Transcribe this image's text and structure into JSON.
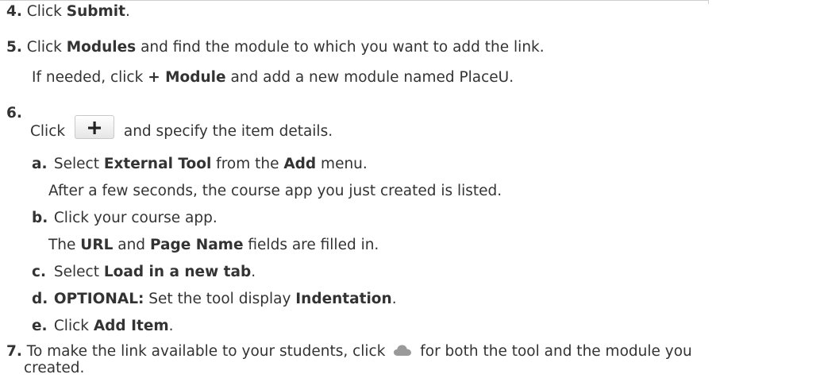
{
  "steps": {
    "s4": {
      "num": "4.",
      "pre": "Click ",
      "b1": "Submit",
      "post": "."
    },
    "s5": {
      "num": "5.",
      "pre": "Click ",
      "b1": "Modules",
      "post": " and find the module to which you want to add the link.",
      "note_pre": "If needed, click ",
      "note_b": "+ Module",
      "note_post": " and add a new module named PlaceU."
    },
    "s6": {
      "num": "6.",
      "pre": "Click",
      "post": "and specify the item details.",
      "a": {
        "letter": "a.",
        "pre": "Select ",
        "b1": "External Tool",
        "mid": " from the ",
        "b2": "Add",
        "post": " menu.",
        "note": "After a few seconds, the course app you just created is listed."
      },
      "b": {
        "letter": "b.",
        "text": "Click your course app.",
        "note_pre": "The ",
        "note_b1": "URL",
        "note_mid": " and ",
        "note_b2": "Page Name",
        "note_post": " fields are filled in."
      },
      "c": {
        "letter": "c.",
        "pre": "Select ",
        "b1": "Load in a new tab",
        "post": "."
      },
      "d": {
        "letter": "d.",
        "b0": "OPTIONAL:",
        "pre": " Set the tool display ",
        "b1": "Indentation",
        "post": "."
      },
      "e": {
        "letter": "e.",
        "pre": "Click ",
        "b1": "Add Item",
        "post": "."
      }
    },
    "s7": {
      "num": "7.",
      "pre": "To make the link available to your students, click",
      "post": "for both the tool and the module you",
      "line2": "created."
    }
  },
  "icons": {
    "plus_button": "plus-icon",
    "publish": "cloud-icon"
  },
  "colors": {
    "text": "#333333",
    "cloud": "#9a9a9a",
    "plus": "#222222"
  }
}
